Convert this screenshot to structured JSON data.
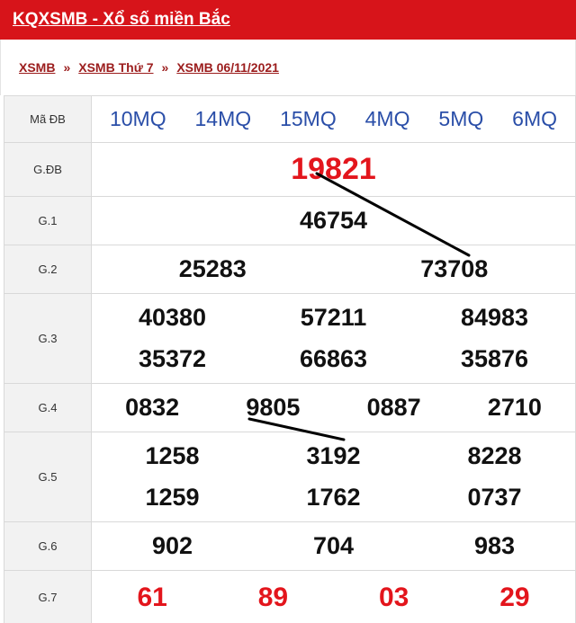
{
  "header": {
    "title": "KQXSMB - Xổ số miền Bắc"
  },
  "breadcrumb": {
    "items": [
      "XSMB",
      "XSMB Thứ 7",
      "XSMB 06/11/2021"
    ],
    "separator": "»"
  },
  "table": {
    "ma_db": {
      "label": "Mã ĐB",
      "codes": [
        "10MQ",
        "14MQ",
        "15MQ",
        "4MQ",
        "5MQ",
        "6MQ"
      ]
    },
    "prizes": {
      "gdb": {
        "label": "G.ĐB",
        "numbers": [
          "19821"
        ]
      },
      "g1": {
        "label": "G.1",
        "numbers": [
          "46754"
        ]
      },
      "g2": {
        "label": "G.2",
        "numbers": [
          "25283",
          "73708"
        ]
      },
      "g3": {
        "label": "G.3",
        "numbers": [
          "40380",
          "57211",
          "84983",
          "35372",
          "66863",
          "35876"
        ]
      },
      "g4": {
        "label": "G.4",
        "numbers": [
          "0832",
          "9805",
          "0887",
          "2710"
        ]
      },
      "g5": {
        "label": "G.5",
        "numbers": [
          "1258",
          "3192",
          "8228",
          "1259",
          "1762",
          "0737"
        ]
      },
      "g6": {
        "label": "G.6",
        "numbers": [
          "902",
          "704",
          "983"
        ]
      },
      "g7": {
        "label": "G.7",
        "numbers": [
          "61",
          "89",
          "03",
          "29"
        ]
      }
    }
  },
  "colors": {
    "header_bg": "#d7141a",
    "breadcrumb_link": "#9b1c1c",
    "code_blue": "#2a4ea8",
    "highlight_red": "#e3151c",
    "label_bg": "#f2f2f2"
  }
}
